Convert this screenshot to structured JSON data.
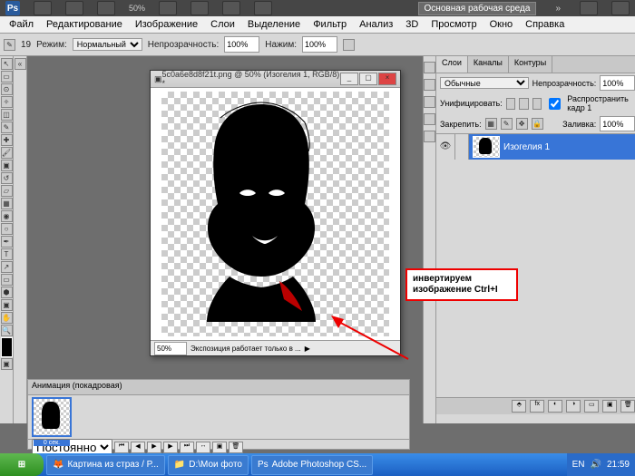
{
  "titlebar": {
    "zoom": "50%",
    "workspace": "Основная рабочая среда"
  },
  "menu": [
    "Файл",
    "Редактирование",
    "Изображение",
    "Слои",
    "Выделение",
    "Фильтр",
    "Анализ",
    "3D",
    "Просмотр",
    "Окно",
    "Справка"
  ],
  "optbar": {
    "mode_lbl": "Режим:",
    "mode": "Нормальный",
    "opacity_lbl": "Непрозрачность:",
    "opacity": "100%",
    "flow_lbl": "Нажим:",
    "flow": "100%",
    "brush": "19"
  },
  "doc": {
    "title": "5c0a6e8d8f21t.png @ 50% (Изогелия 1, RGB/8) *",
    "zoom": "50%",
    "status": "Экспозиция работает только в ...",
    "min": "_",
    "max": "▢",
    "close": "×"
  },
  "annotation": {
    "l1": "инвертируем",
    "l2": "изображение Ctrl+I"
  },
  "layers": {
    "tabs": [
      "Слои",
      "Каналы",
      "Контуры"
    ],
    "blend": "Обычные",
    "opacity_lbl": "Непрозрачность:",
    "opacity": "100%",
    "unify_lbl": "Унифицировать:",
    "spread": "Распространить кадр 1",
    "lock_lbl": "Закрепить:",
    "fill_lbl": "Заливка:",
    "fill": "100%",
    "item": "Изогелия 1"
  },
  "anim": {
    "title": "Анимация (покадровая)",
    "frame": "0 сек.",
    "loop": "Постоянно"
  },
  "taskbar": {
    "task1": "Картина из страз / Р...",
    "task2": "D:\\Мои фото",
    "task3": "Adobe Photoshop CS...",
    "lang": "EN",
    "time": "21:59"
  }
}
